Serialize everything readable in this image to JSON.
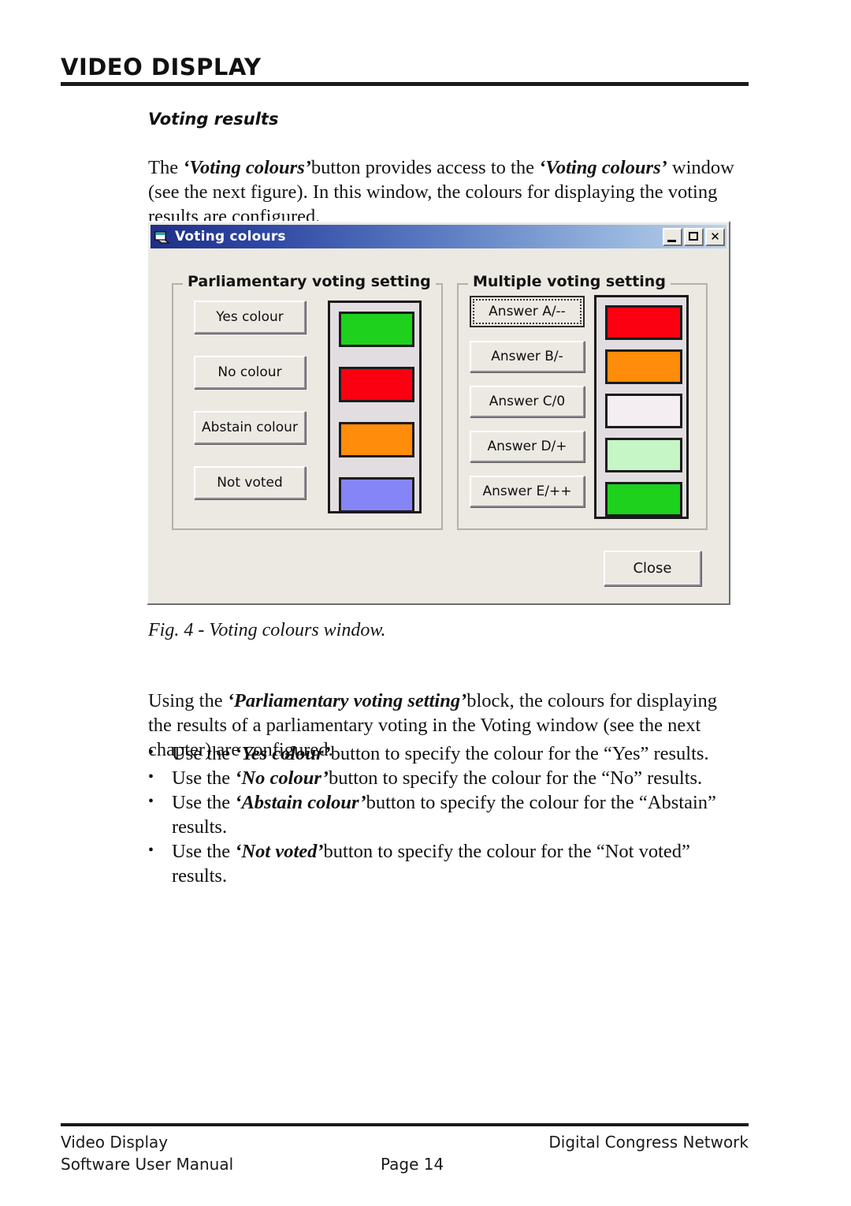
{
  "page": {
    "heading": "VIDEO DISPLAY",
    "subheading": "Voting results",
    "intro_paragraph_parts": {
      "t1": "The ",
      "i1": "‘Voting colours’",
      "t2": "button provides access to the ",
      "i2": "‘Voting colours’",
      "t3": " window (see the next figure). In this window, the colours for displaying the  voting results are configured."
    },
    "figure_caption": "Fig. 4 - Voting colours window.",
    "usage_paragraph_parts": {
      "t1": "Using the ",
      "i1": "‘Parliamentary voting setting’",
      "t2": "block, the colours for displaying the results of a parliamentary voting in the Voting window (see the next chapter) are configured."
    },
    "bullets": [
      {
        "pre": "Use the ",
        "em": "‘Yes colour’",
        "post": "button to specify the colour for the “Yes” results."
      },
      {
        "pre": "Use the ",
        "em": "‘No colour’",
        "post": "button to specify the colour for the “No” results."
      },
      {
        "pre": "Use the ",
        "em": "‘Abstain colour’",
        "post": "button to specify the colour for the “Abstain” results."
      },
      {
        "pre": "Use the ",
        "em": "‘Not voted’",
        "post": "button to specify the colour for the “Not voted” results."
      }
    ]
  },
  "dialog": {
    "title": "Voting colours",
    "title_icon": "application-window-icon",
    "window_buttons": [
      {
        "name": "minimize",
        "label": "–"
      },
      {
        "name": "maximize",
        "label": "□"
      },
      {
        "name": "close",
        "label": "×"
      }
    ],
    "parliamentary": {
      "group_title": "Parliamentary voting setting",
      "rows": [
        {
          "label": "Yes colour",
          "colour": "#1dd11d"
        },
        {
          "label": "No colour",
          "colour": "#fa0010"
        },
        {
          "label": "Abstain colour",
          "colour": "#ff8c0a"
        },
        {
          "label": "Not voted",
          "colour": "#8585f7"
        }
      ]
    },
    "multiple": {
      "group_title": "Multiple voting setting",
      "rows": [
        {
          "label": "Answer A/--",
          "colour": "#fa0010",
          "default": true
        },
        {
          "label": "Answer B/-",
          "colour": "#ff8c0a",
          "default": false
        },
        {
          "label": "Answer C/0",
          "colour": "#f4eef3",
          "default": false
        },
        {
          "label": "Answer D/+",
          "colour": "#c6f5c6",
          "default": false
        },
        {
          "label": "Answer E/++",
          "colour": "#1dd11d",
          "default": false
        }
      ]
    },
    "close_label": "Close"
  },
  "footer": {
    "line1_left": "Video Display",
    "line2_left": "Software User Manual",
    "page_label": "Page 14",
    "right": "Digital Congress Network"
  }
}
